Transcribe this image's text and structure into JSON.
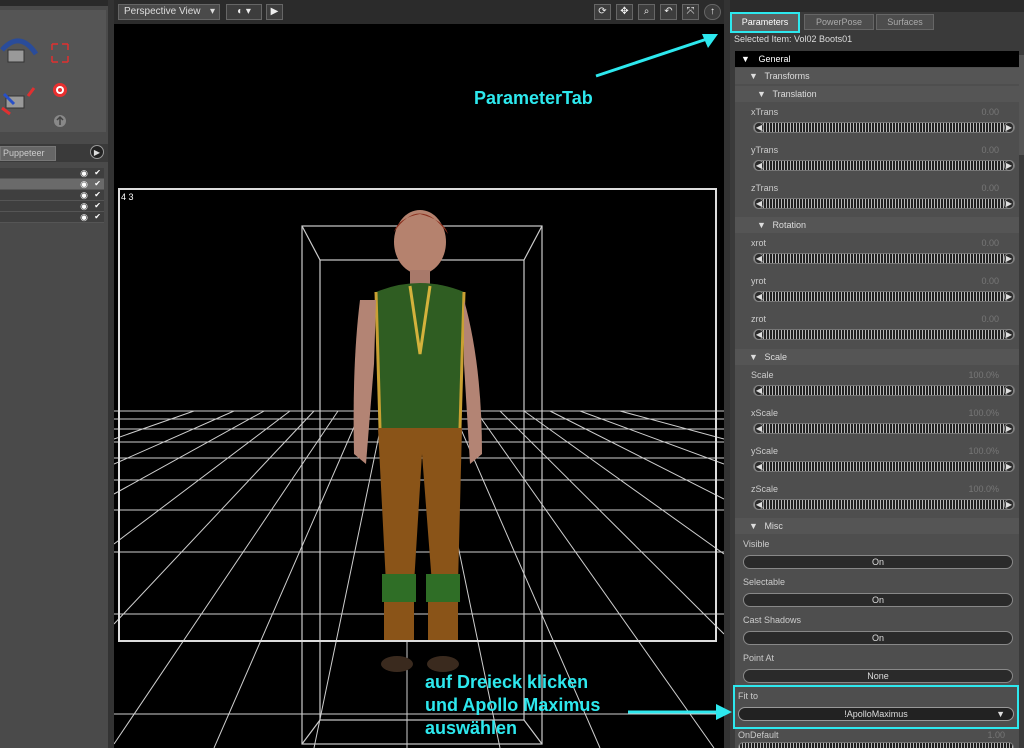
{
  "left_panel": {
    "tab_label": "Puppeteer",
    "menu_arrow_glyph": "▶",
    "scene_rows": [
      {
        "selected": false
      },
      {
        "selected": true
      },
      {
        "selected": false
      },
      {
        "selected": false
      },
      {
        "selected": false
      }
    ]
  },
  "viewport": {
    "view_label": "Perspective View",
    "frame_label": "4 3",
    "toolbar_icons": [
      "rotate-icon",
      "move-icon",
      "zoom-icon",
      "orbit-icon",
      "scale-icon",
      "info-icon"
    ]
  },
  "right_panel": {
    "tabs": [
      "Parameters",
      "PowerPose",
      "Surfaces"
    ],
    "active_tab": "Parameters",
    "selected_item": "Selected Item: Vol02 Boots01",
    "sections": {
      "general": "General",
      "transforms": "Transforms",
      "translation": "Translation",
      "rotation": "Rotation",
      "scale": "Scale",
      "misc": "Misc"
    },
    "translation": [
      {
        "label": "xTrans",
        "value": "0.00"
      },
      {
        "label": "yTrans",
        "value": "0.00"
      },
      {
        "label": "zTrans",
        "value": "0.00"
      }
    ],
    "rotation": [
      {
        "label": "xrot",
        "value": "0.00"
      },
      {
        "label": "yrot",
        "value": "0.00"
      },
      {
        "label": "zrot",
        "value": "0.00"
      }
    ],
    "scale": [
      {
        "label": "Scale",
        "value": "100.0%"
      },
      {
        "label": "xScale",
        "value": "100.0%"
      },
      {
        "label": "yScale",
        "value": "100.0%"
      },
      {
        "label": "zScale",
        "value": "100.0%"
      }
    ],
    "misc": [
      {
        "label": "Visible",
        "value": "On"
      },
      {
        "label": "Selectable",
        "value": "On"
      },
      {
        "label": "Cast Shadows",
        "value": "On"
      },
      {
        "label": "Point At",
        "value": "None"
      }
    ],
    "fit_to": {
      "label": "Fit to",
      "value": "!ApolloMaximus"
    },
    "on_default": {
      "label": "OnDefault",
      "value": "1.00"
    }
  },
  "annotations": {
    "parameter_tab": "ParameterTab",
    "instruction_line1": "auf Dreieck klicken",
    "instruction_line2": "und Apollo Maximus",
    "instruction_line3": "auswählen",
    "color": "#2de8ee"
  }
}
